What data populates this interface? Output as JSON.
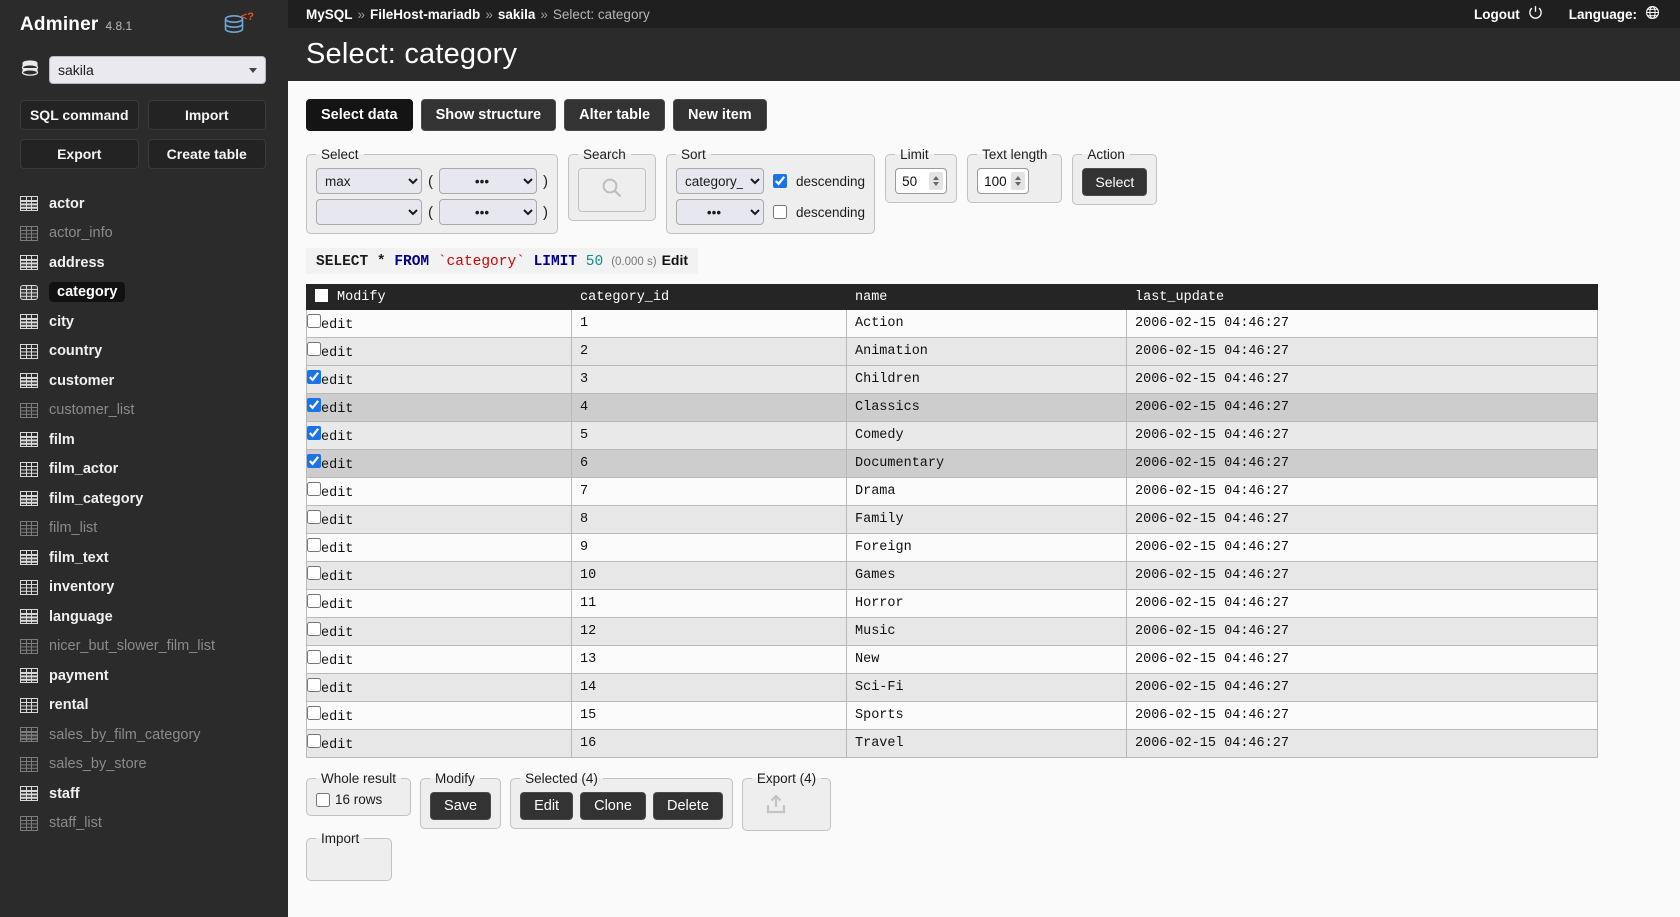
{
  "sidebar": {
    "brand": "Adminer",
    "version": "4.8.1",
    "logo_icon": "database-logo-icon",
    "db_icon": "database-icon",
    "db_selected": "sakila",
    "buttons": [
      {
        "label": "SQL command",
        "name": "sql-command-button"
      },
      {
        "label": "Import",
        "name": "import-button"
      },
      {
        "label": "Export",
        "name": "export-button"
      },
      {
        "label": "Create table",
        "name": "create-table-button"
      }
    ],
    "tables": [
      {
        "label": "actor",
        "view": false,
        "active": false
      },
      {
        "label": "actor_info",
        "view": true,
        "active": false
      },
      {
        "label": "address",
        "view": false,
        "active": false
      },
      {
        "label": "category",
        "view": false,
        "active": true
      },
      {
        "label": "city",
        "view": false,
        "active": false
      },
      {
        "label": "country",
        "view": false,
        "active": false
      },
      {
        "label": "customer",
        "view": false,
        "active": false
      },
      {
        "label": "customer_list",
        "view": true,
        "active": false
      },
      {
        "label": "film",
        "view": false,
        "active": false
      },
      {
        "label": "film_actor",
        "view": false,
        "active": false
      },
      {
        "label": "film_category",
        "view": false,
        "active": false
      },
      {
        "label": "film_list",
        "view": true,
        "active": false
      },
      {
        "label": "film_text",
        "view": false,
        "active": false
      },
      {
        "label": "inventory",
        "view": false,
        "active": false
      },
      {
        "label": "language",
        "view": false,
        "active": false
      },
      {
        "label": "nicer_but_slower_film_list",
        "view": true,
        "active": false
      },
      {
        "label": "payment",
        "view": false,
        "active": false
      },
      {
        "label": "rental",
        "view": false,
        "active": false
      },
      {
        "label": "sales_by_film_category",
        "view": true,
        "active": false
      },
      {
        "label": "sales_by_store",
        "view": true,
        "active": false
      },
      {
        "label": "staff",
        "view": false,
        "active": false
      },
      {
        "label": "staff_list",
        "view": true,
        "active": false
      }
    ]
  },
  "topbar": {
    "crumb_system": "MySQL",
    "crumb_server": "FileHost-mariadb",
    "crumb_db": "sakila",
    "crumb_current": "Select: category",
    "separator": "»",
    "logout_label": "Logout",
    "logout_icon": "power-icon",
    "language_label": "Language:",
    "language_icon": "globe-icon"
  },
  "page": {
    "title": "Select: category"
  },
  "tabs": [
    {
      "label": "Select data",
      "selected": true,
      "name": "tab-select-data"
    },
    {
      "label": "Show structure",
      "selected": false,
      "name": "tab-show-structure"
    },
    {
      "label": "Alter table",
      "selected": false,
      "name": "tab-alter-table"
    },
    {
      "label": "New item",
      "selected": false,
      "name": "tab-new-item"
    }
  ],
  "filters": {
    "select": {
      "legend": "Select",
      "rows": [
        {
          "func": "max",
          "col": "•••"
        },
        {
          "func": "",
          "col": "•••"
        }
      ],
      "open_paren": "(",
      "close_paren": ")"
    },
    "search": {
      "legend": "Search",
      "icon": "search-icon"
    },
    "sort": {
      "legend": "Sort",
      "rows": [
        {
          "col": "category_id",
          "descending_label": "descending",
          "descending": true
        },
        {
          "col": "•••",
          "descending_label": "descending",
          "descending": false
        }
      ]
    },
    "limit": {
      "legend": "Limit",
      "value": "50"
    },
    "text_length": {
      "legend": "Text length",
      "value": "100"
    },
    "action": {
      "legend": "Action",
      "button_label": "Select"
    }
  },
  "sql": {
    "select_kw": "SELECT",
    "star": "*",
    "from_kw": "FROM",
    "table": "`category`",
    "limit_kw": "LIMIT",
    "limit_value": "50",
    "time": "(0.000 s)",
    "edit_label": "Edit"
  },
  "table": {
    "columns": [
      "Modify",
      "category_id",
      "name",
      "last_update"
    ],
    "edit_label": "edit",
    "rows": [
      {
        "checked": false,
        "category_id": "1",
        "name": "Action",
        "last_update": "2006-02-15 04:46:27"
      },
      {
        "checked": false,
        "category_id": "2",
        "name": "Animation",
        "last_update": "2006-02-15 04:46:27"
      },
      {
        "checked": true,
        "category_id": "3",
        "name": "Children",
        "last_update": "2006-02-15 04:46:27"
      },
      {
        "checked": true,
        "category_id": "4",
        "name": "Classics",
        "last_update": "2006-02-15 04:46:27"
      },
      {
        "checked": true,
        "category_id": "5",
        "name": "Comedy",
        "last_update": "2006-02-15 04:46:27"
      },
      {
        "checked": true,
        "category_id": "6",
        "name": "Documentary",
        "last_update": "2006-02-15 04:46:27"
      },
      {
        "checked": false,
        "category_id": "7",
        "name": "Drama",
        "last_update": "2006-02-15 04:46:27"
      },
      {
        "checked": false,
        "category_id": "8",
        "name": "Family",
        "last_update": "2006-02-15 04:46:27"
      },
      {
        "checked": false,
        "category_id": "9",
        "name": "Foreign",
        "last_update": "2006-02-15 04:46:27"
      },
      {
        "checked": false,
        "category_id": "10",
        "name": "Games",
        "last_update": "2006-02-15 04:46:27"
      },
      {
        "checked": false,
        "category_id": "11",
        "name": "Horror",
        "last_update": "2006-02-15 04:46:27"
      },
      {
        "checked": false,
        "category_id": "12",
        "name": "Music",
        "last_update": "2006-02-15 04:46:27"
      },
      {
        "checked": false,
        "category_id": "13",
        "name": "New",
        "last_update": "2006-02-15 04:46:27"
      },
      {
        "checked": false,
        "category_id": "14",
        "name": "Sci-Fi",
        "last_update": "2006-02-15 04:46:27"
      },
      {
        "checked": false,
        "category_id": "15",
        "name": "Sports",
        "last_update": "2006-02-15 04:46:27"
      },
      {
        "checked": false,
        "category_id": "16",
        "name": "Travel",
        "last_update": "2006-02-15 04:46:27"
      }
    ]
  },
  "footer": {
    "whole_result": {
      "legend": "Whole result",
      "rows_label": "16 rows",
      "checked": false
    },
    "modify": {
      "legend": "Modify",
      "save_label": "Save"
    },
    "selected": {
      "legend": "Selected (4)",
      "edit_label": "Edit",
      "clone_label": "Clone",
      "delete_label": "Delete"
    },
    "export": {
      "legend": "Export (4)",
      "icon": "upload-icon"
    },
    "import": {
      "legend": "Import"
    }
  }
}
